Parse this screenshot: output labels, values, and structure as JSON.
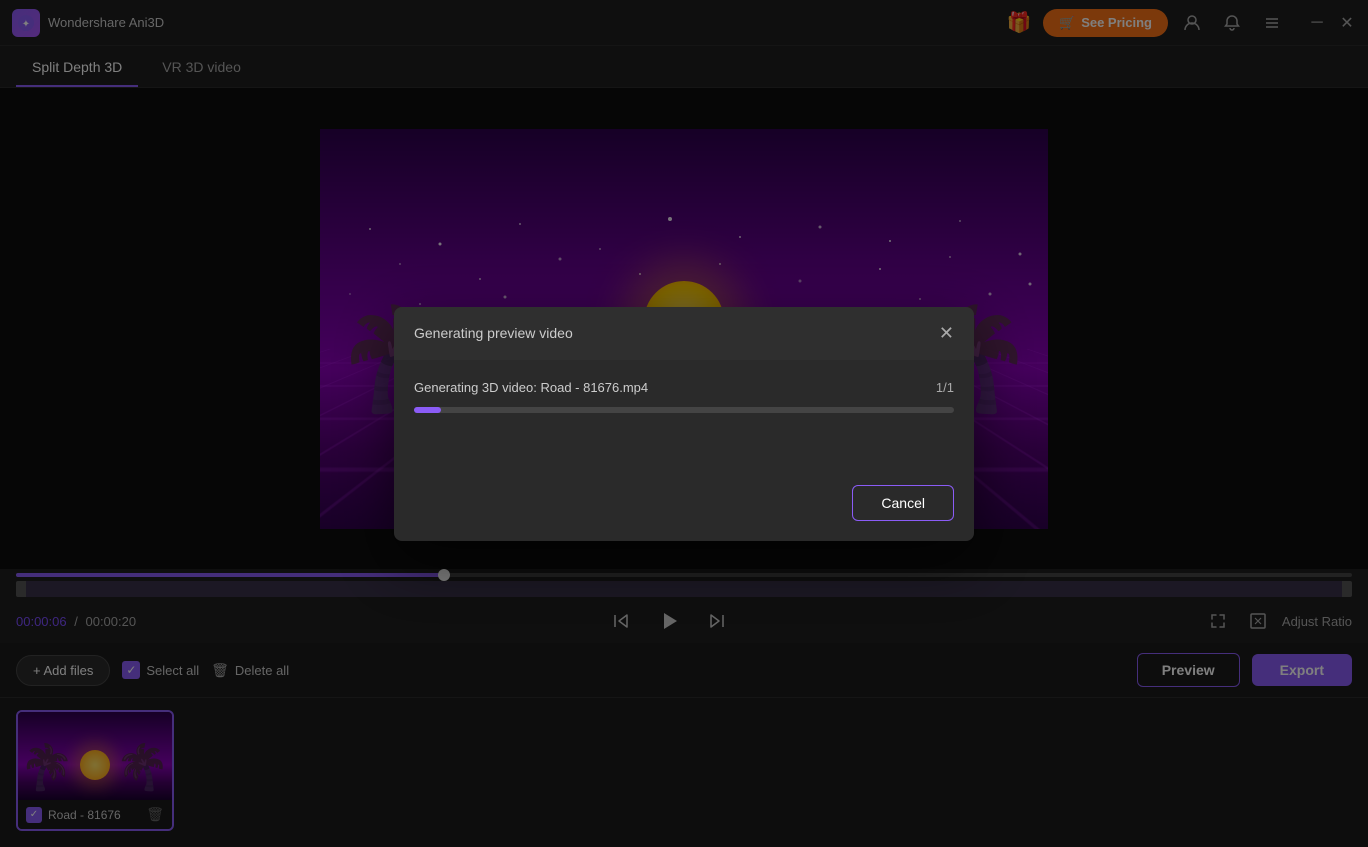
{
  "titleBar": {
    "appName": "Wondershare Ani3D",
    "giftIcon": "🎁",
    "seePricingLabel": "See Pricing",
    "userIcon": "👤",
    "notifIcon": "🔔",
    "menuIcon": "☰",
    "minimizeIcon": "─",
    "closeIcon": "✕"
  },
  "tabs": [
    {
      "id": "split-depth",
      "label": "Split Depth 3D",
      "active": true
    },
    {
      "id": "vr-3d",
      "label": "VR 3D video",
      "active": false
    }
  ],
  "player": {
    "currentTime": "00:00:06",
    "totalTime": "00:00:20",
    "seekPercent": 32,
    "adjustRatioLabel": "Adjust Ratio"
  },
  "fileToolbar": {
    "addFilesLabel": "+ Add files",
    "selectAllLabel": "Select all",
    "deleteAllLabel": "Delete all",
    "previewLabel": "Preview",
    "exportLabel": "Export"
  },
  "files": [
    {
      "name": "Road - 81676",
      "checked": true
    }
  ],
  "modal": {
    "title": "Generating preview video",
    "progressLabel": "Generating 3D video: Road - 81676.mp4",
    "progressCount": "1/1",
    "progressPercent": 5,
    "cancelLabel": "Cancel"
  }
}
